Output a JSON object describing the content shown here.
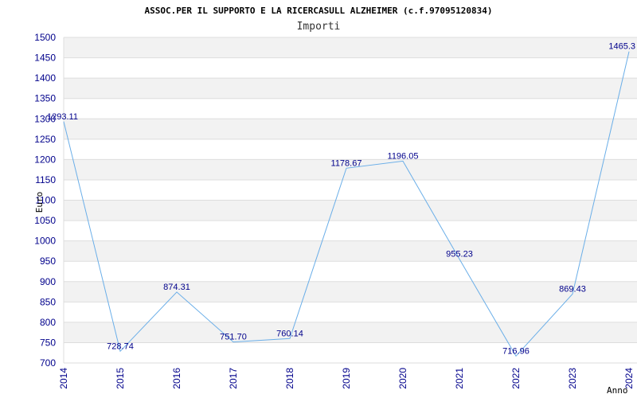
{
  "chart_data": {
    "type": "line",
    "title": "ASSOC.PER IL SUPPORTO E LA RICERCASULL ALZHEIMER (c.f.97095120834)",
    "subtitle": "Importi",
    "xlabel": "Anno",
    "ylabel": "Euro",
    "ylim": [
      700,
      1500
    ],
    "ytick_step": 50,
    "grid": true,
    "categories": [
      "2014",
      "2015",
      "2016",
      "2017",
      "2018",
      "2019",
      "2020",
      "2021",
      "2022",
      "2023",
      "2024"
    ],
    "series": [
      {
        "values": [
          1293.11,
          728.74,
          874.31,
          751.7,
          760.14,
          1178.67,
          1196.05,
          955.23,
          716.96,
          869.43,
          1465.3
        ],
        "labels": [
          "1293.11",
          "728.74",
          "874.31",
          "751.70",
          "760.14",
          "1178.67",
          "1196.05",
          "955.23",
          "716.96",
          "869.43",
          "1465.3"
        ]
      }
    ],
    "colors": {
      "line": "#6aaee8",
      "band": "#f2f2f2",
      "grid": "#dddddd",
      "text": "#00008b"
    }
  }
}
